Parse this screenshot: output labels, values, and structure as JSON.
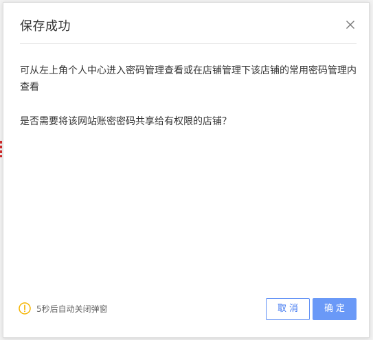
{
  "modal": {
    "title": "保存成功",
    "close_icon": "close-icon",
    "body": {
      "paragraph_1": "可从左上角个人中心进入密码管理查看或在店铺管理下该店铺的常用密码管理内查看",
      "paragraph_2": "是否需要将该网站账密密码共享给有权限的店铺？"
    },
    "footer": {
      "countdown_icon": "warning-circle-icon",
      "countdown_text": "5秒后自动关闭弹窗",
      "cancel_label": "取消",
      "ok_label": "确定"
    }
  },
  "colors": {
    "primary": "#6a99f7",
    "primary_border": "#5b8df5",
    "warning": "#f5b400",
    "text": "#333333",
    "muted_text": "#666666"
  }
}
